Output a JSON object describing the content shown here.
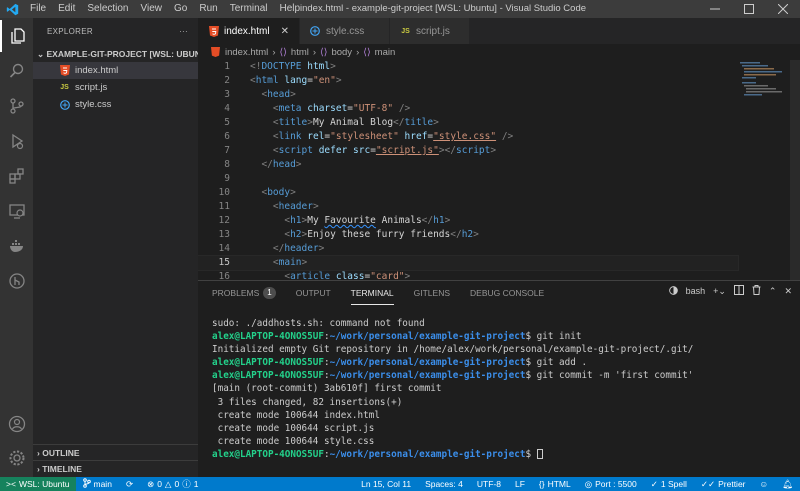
{
  "titlebar": {
    "menu": [
      "File",
      "Edit",
      "Selection",
      "View",
      "Go",
      "Run",
      "Terminal",
      "Help"
    ],
    "title": "index.html - example-git-project [WSL: Ubuntu] - Visual Studio Code"
  },
  "sidebar": {
    "header": "EXPLORER",
    "more": "···",
    "project": "EXAMPLE-GIT-PROJECT [WSL: UBUN...",
    "files": [
      {
        "name": "index.html",
        "icon": "html-file-icon"
      },
      {
        "name": "script.js",
        "icon": "js-file-icon"
      },
      {
        "name": "style.css",
        "icon": "css-file-icon"
      }
    ],
    "outline": "OUTLINE",
    "timeline": "TIMELINE"
  },
  "tabs": [
    {
      "label": "index.html",
      "active": true
    },
    {
      "label": "style.css",
      "active": false
    },
    {
      "label": "script.js",
      "active": false
    }
  ],
  "breadcrumb": [
    "index.html",
    "html",
    "body",
    "main"
  ],
  "code": {
    "lines": [
      "1",
      "2",
      "3",
      "4",
      "5",
      "6",
      "7",
      "8",
      "9",
      "10",
      "11",
      "12",
      "13",
      "14",
      "15",
      "16"
    ],
    "current_line": "15"
  },
  "panel": {
    "tabs": [
      "PROBLEMS",
      "OUTPUT",
      "TERMINAL",
      "GITLENS",
      "DEBUG CONSOLE"
    ],
    "problems_count": "1",
    "shell": "bash",
    "terminal": {
      "l1": "sudo: ./addhosts.sh: command not found",
      "user": "alex@LAPTOP-4ONOS5UF",
      "path": "~/work/personal/example-git-project",
      "cmd1": "git init",
      "out1": "Initialized empty Git repository in /home/alex/work/personal/example-git-project/.git/",
      "cmd2": "git add .",
      "cmd3": "git commit -m 'first commit'",
      "out2": "[main (root-commit) 3ab610f] first commit",
      "out3": " 3 files changed, 82 insertions(+)",
      "out4": " create mode 100644 index.html",
      "out5": " create mode 100644 script.js",
      "out6": " create mode 100644 style.css"
    }
  },
  "status": {
    "remote": "WSL: Ubuntu",
    "branch": "main",
    "errors": "0",
    "warnings": "0",
    "info": "1",
    "position": "Ln 15, Col 11",
    "spaces": "Spaces: 4",
    "encoding": "UTF-8",
    "eol": "LF",
    "language": "HTML",
    "port": "Port : 5500",
    "spell": "1 Spell",
    "prettier": "Prettier"
  }
}
